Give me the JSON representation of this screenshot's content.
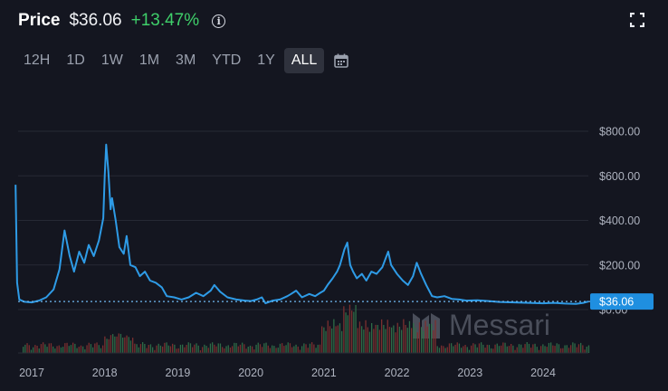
{
  "header": {
    "title": "Price",
    "price": "$36.06",
    "change": "+13.47%",
    "info_icon": "info-icon",
    "fullscreen_icon": "fullscreen-icon"
  },
  "ranges": [
    {
      "label": "12H",
      "active": false
    },
    {
      "label": "1D",
      "active": false
    },
    {
      "label": "1W",
      "active": false
    },
    {
      "label": "1M",
      "active": false
    },
    {
      "label": "3M",
      "active": false
    },
    {
      "label": "YTD",
      "active": false
    },
    {
      "label": "1Y",
      "active": false
    },
    {
      "label": "ALL",
      "active": true
    }
  ],
  "calendar_icon": "calendar-icon",
  "watermark": "Messari",
  "colors": {
    "line": "#2e9be6",
    "positive": "#3fcf6a",
    "current_tag": "#1f8fe0",
    "volume_up": "#2e6b47",
    "volume_down": "#7a2f2f"
  },
  "chart_data": {
    "type": "line",
    "y_ticks": [
      "$800.00",
      "$600.00",
      "$400.00",
      "$200.00",
      "$0.00"
    ],
    "ylim": [
      0,
      800
    ],
    "x_ticks": [
      "2017",
      "2018",
      "2019",
      "2020",
      "2021",
      "2022",
      "2023",
      "2024"
    ],
    "current_value_label": "$36.06",
    "current_value": 36.06,
    "grid": true,
    "series": [
      {
        "values": [
          [
            2016.78,
            560
          ],
          [
            2016.8,
            120
          ],
          [
            2016.83,
            45
          ],
          [
            2016.9,
            35
          ],
          [
            2017.0,
            32
          ],
          [
            2017.1,
            40
          ],
          [
            2017.2,
            55
          ],
          [
            2017.3,
            90
          ],
          [
            2017.38,
            180
          ],
          [
            2017.45,
            355
          ],
          [
            2017.52,
            240
          ],
          [
            2017.58,
            170
          ],
          [
            2017.65,
            260
          ],
          [
            2017.72,
            210
          ],
          [
            2017.78,
            290
          ],
          [
            2017.85,
            240
          ],
          [
            2017.92,
            310
          ],
          [
            2017.98,
            410
          ],
          [
            2018.0,
            600
          ],
          [
            2018.02,
            740
          ],
          [
            2018.05,
            620
          ],
          [
            2018.08,
            450
          ],
          [
            2018.1,
            500
          ],
          [
            2018.15,
            400
          ],
          [
            2018.2,
            280
          ],
          [
            2018.26,
            250
          ],
          [
            2018.3,
            330
          ],
          [
            2018.35,
            200
          ],
          [
            2018.42,
            190
          ],
          [
            2018.48,
            150
          ],
          [
            2018.55,
            170
          ],
          [
            2018.62,
            130
          ],
          [
            2018.7,
            120
          ],
          [
            2018.78,
            100
          ],
          [
            2018.85,
            60
          ],
          [
            2018.95,
            55
          ],
          [
            2019.05,
            45
          ],
          [
            2019.15,
            55
          ],
          [
            2019.25,
            75
          ],
          [
            2019.35,
            60
          ],
          [
            2019.45,
            85
          ],
          [
            2019.5,
            110
          ],
          [
            2019.58,
            80
          ],
          [
            2019.68,
            55
          ],
          [
            2019.8,
            45
          ],
          [
            2019.92,
            40
          ],
          [
            2020.0,
            38
          ],
          [
            2020.08,
            45
          ],
          [
            2020.15,
            55
          ],
          [
            2020.2,
            28
          ],
          [
            2020.3,
            40
          ],
          [
            2020.4,
            45
          ],
          [
            2020.5,
            60
          ],
          [
            2020.55,
            70
          ],
          [
            2020.62,
            85
          ],
          [
            2020.7,
            55
          ],
          [
            2020.8,
            70
          ],
          [
            2020.88,
            60
          ],
          [
            2020.95,
            75
          ],
          [
            2021.0,
            85
          ],
          [
            2021.05,
            110
          ],
          [
            2021.12,
            140
          ],
          [
            2021.18,
            170
          ],
          [
            2021.22,
            200
          ],
          [
            2021.28,
            270
          ],
          [
            2021.32,
            300
          ],
          [
            2021.36,
            200
          ],
          [
            2021.4,
            170
          ],
          [
            2021.45,
            140
          ],
          [
            2021.52,
            160
          ],
          [
            2021.58,
            130
          ],
          [
            2021.65,
            170
          ],
          [
            2021.72,
            160
          ],
          [
            2021.8,
            190
          ],
          [
            2021.88,
            260
          ],
          [
            2021.92,
            200
          ],
          [
            2022.0,
            160
          ],
          [
            2022.08,
            130
          ],
          [
            2022.15,
            110
          ],
          [
            2022.22,
            150
          ],
          [
            2022.27,
            210
          ],
          [
            2022.33,
            160
          ],
          [
            2022.4,
            110
          ],
          [
            2022.48,
            60
          ],
          [
            2022.55,
            55
          ],
          [
            2022.65,
            60
          ],
          [
            2022.75,
            48
          ],
          [
            2022.85,
            45
          ],
          [
            2022.95,
            40
          ],
          [
            2023.1,
            42
          ],
          [
            2023.25,
            38
          ],
          [
            2023.4,
            34
          ],
          [
            2023.6,
            32
          ],
          [
            2023.8,
            30
          ],
          [
            2024.0,
            28
          ],
          [
            2024.15,
            30
          ],
          [
            2024.3,
            27
          ],
          [
            2024.45,
            25
          ],
          [
            2024.55,
            30
          ],
          [
            2024.62,
            36
          ]
        ]
      }
    ]
  }
}
